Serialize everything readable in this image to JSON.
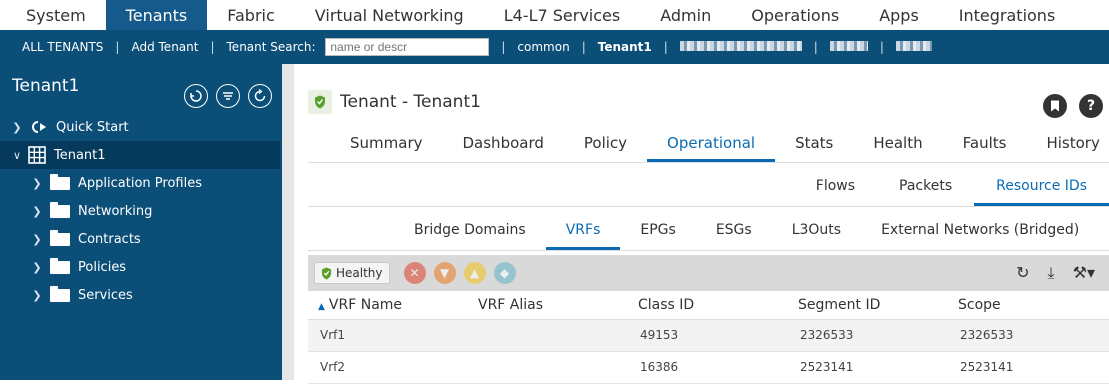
{
  "topnav": {
    "items": [
      {
        "label": "System"
      },
      {
        "label": "Tenants",
        "active": true
      },
      {
        "label": "Fabric"
      },
      {
        "label": "Virtual Networking"
      },
      {
        "label": "L4-L7 Services"
      },
      {
        "label": "Admin"
      },
      {
        "label": "Operations"
      },
      {
        "label": "Apps"
      },
      {
        "label": "Integrations"
      }
    ]
  },
  "subnav": {
    "all_tenants": "ALL TENANTS",
    "add_tenant": "Add Tenant",
    "search_label": "Tenant Search:",
    "search_placeholder": "name or descr",
    "common": "common",
    "tenant1": "Tenant1",
    "separator": "|"
  },
  "sidebar": {
    "title": "Tenant1",
    "quick_start": "Quick Start",
    "tenant": "Tenant1",
    "folders": [
      "Application Profiles",
      "Networking",
      "Contracts",
      "Policies",
      "Services"
    ]
  },
  "main": {
    "header_prefix": "Tenant - ",
    "header_name": "Tenant1",
    "tabs": [
      "Summary",
      "Dashboard",
      "Policy",
      "Operational",
      "Stats",
      "Health",
      "Faults",
      "History"
    ],
    "active_tab": "Operational",
    "subtabs": [
      "Flows",
      "Packets",
      "Resource IDs"
    ],
    "active_subtab": "Resource IDs",
    "subsubtabs": [
      "Bridge Domains",
      "VRFs",
      "EPGs",
      "ESGs",
      "L3Outs",
      "External Networks (Bridged)"
    ],
    "active_subsubtab": "VRFs",
    "health_label": "Healthy"
  },
  "table": {
    "columns": [
      "VRF Name",
      "VRF Alias",
      "Class ID",
      "Segment ID",
      "Scope"
    ],
    "rows": [
      {
        "name": "Vrf1",
        "alias": "",
        "class_id": "49153",
        "segment_id": "2326533",
        "scope": "2326533"
      },
      {
        "name": "Vrf2",
        "alias": "",
        "class_id": "16386",
        "segment_id": "2523141",
        "scope": "2523141"
      }
    ]
  },
  "colors": {
    "nav_dark": "#0b4e78",
    "accent": "#0a6bb5",
    "healthy_green": "#5aa02c"
  }
}
